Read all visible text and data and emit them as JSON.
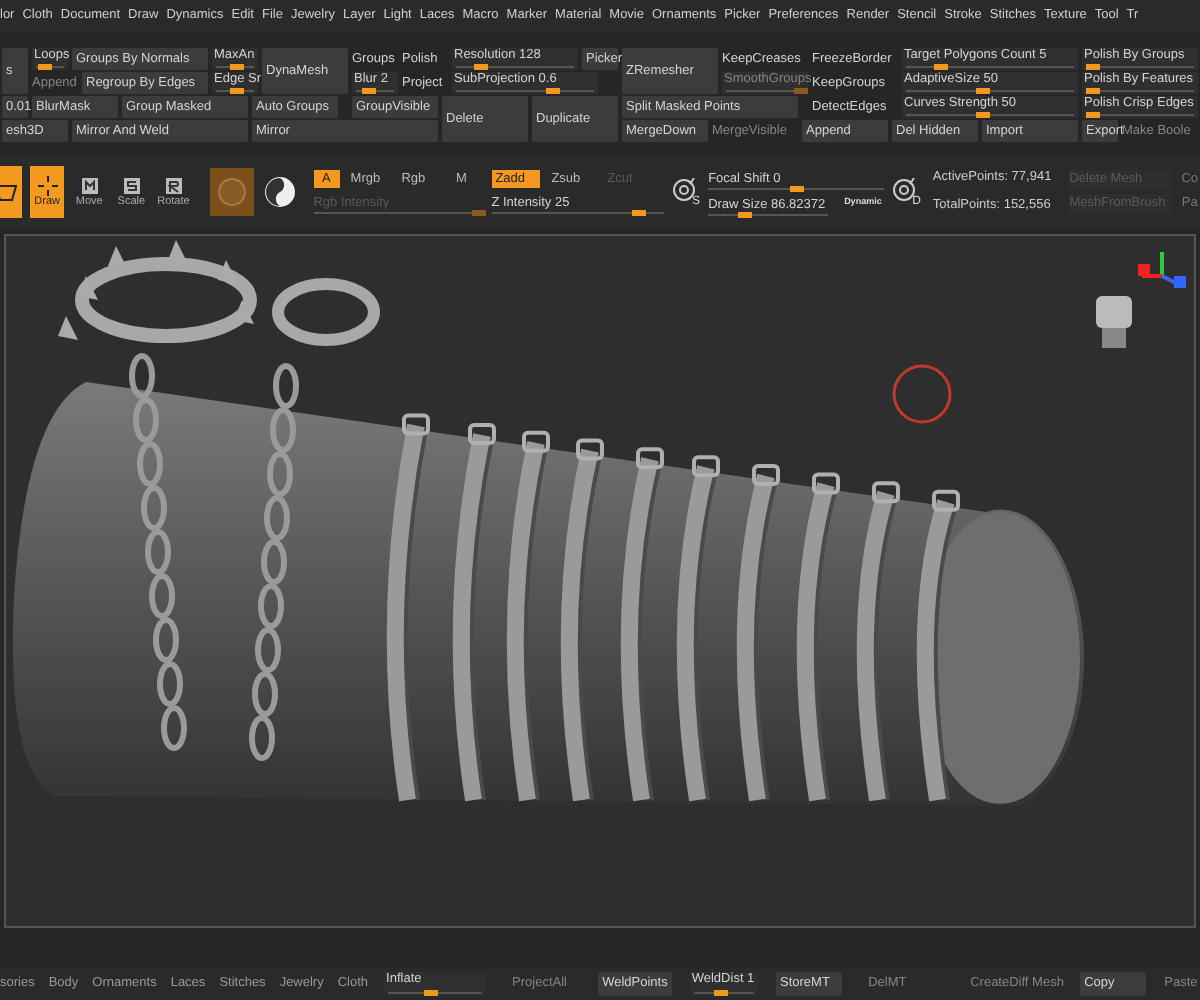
{
  "menu_bar": [
    "lor",
    "Cloth",
    "Document",
    "Draw",
    "Dynamics",
    "Edit",
    "File",
    "Jewelry",
    "Layer",
    "Light",
    "Laces",
    "Macro",
    "Marker",
    "Material",
    "Movie",
    "Ornaments",
    "Picker",
    "Preferences",
    "Render",
    "Stencil",
    "Stroke",
    "Stitches",
    "Texture",
    "Tool",
    "Tr"
  ],
  "palette": [
    {
      "label": "s",
      "kind": "button",
      "disabled": false
    },
    {
      "label": "Loops",
      "kind": "slider",
      "disabled": false,
      "level": 0.3
    },
    {
      "label": "Groups By Normals",
      "kind": "button",
      "disabled": false
    },
    {
      "label": "MaxAn",
      "kind": "slider",
      "disabled": false,
      "level": 0.5
    },
    {
      "label": "DynaMesh",
      "kind": "button",
      "disabled": false
    },
    {
      "label": "Groups",
      "kind": "toggle",
      "disabled": false
    },
    {
      "label": "Polish",
      "kind": "toggle",
      "disabled": false
    },
    {
      "label": "Resolution 128",
      "kind": "slider",
      "disabled": false,
      "level": 0.2
    },
    {
      "label": "Picker",
      "kind": "button",
      "disabled": false
    },
    {
      "label": "ZRemesher",
      "kind": "button",
      "disabled": false
    },
    {
      "label": "KeepCreases",
      "kind": "toggle",
      "disabled": false
    },
    {
      "label": "FreezeBorder",
      "kind": "toggle",
      "disabled": false
    },
    {
      "label": "Target Polygons Count 5",
      "kind": "slider",
      "disabled": false,
      "level": 0.2
    },
    {
      "label": "Polish By Groups",
      "kind": "slider",
      "disabled": false,
      "level": 0.05
    },
    {
      "label": "Append",
      "kind": "toggle",
      "disabled": true
    },
    {
      "label": "Regroup By Edges",
      "kind": "button",
      "disabled": false
    },
    {
      "label": "Edge Sr",
      "kind": "slider",
      "disabled": false,
      "level": 0.5
    },
    {
      "label": "Blur 2",
      "kind": "slider",
      "disabled": false,
      "level": 0.3
    },
    {
      "label": "Project",
      "kind": "toggle",
      "disabled": false
    },
    {
      "label": "SubProjection 0.6",
      "kind": "slider",
      "disabled": false,
      "level": 0.7
    },
    {
      "label": "SmoothGroups",
      "kind": "slider",
      "disabled": true,
      "level": 0.95
    },
    {
      "label": "KeepGroups",
      "kind": "toggle",
      "disabled": false
    },
    {
      "label": "AdaptiveSize 50",
      "kind": "slider",
      "disabled": false,
      "level": 0.45
    },
    {
      "label": "Polish By Features",
      "kind": "slider",
      "disabled": false,
      "level": 0.05
    },
    {
      "label": "0.01",
      "kind": "button",
      "disabled": false
    },
    {
      "label": "BlurMask",
      "kind": "button",
      "disabled": false
    },
    {
      "label": "Group Masked",
      "kind": "button",
      "disabled": false
    },
    {
      "label": "Auto Groups",
      "kind": "button",
      "disabled": false
    },
    {
      "label": "GroupVisible",
      "kind": "button",
      "disabled": false
    },
    {
      "label": "Delete",
      "kind": "button",
      "disabled": false
    },
    {
      "label": "Duplicate",
      "kind": "button",
      "disabled": false
    },
    {
      "label": "Split Masked Points",
      "kind": "button",
      "disabled": false
    },
    {
      "label": "DetectEdges",
      "kind": "toggle",
      "disabled": false
    },
    {
      "label": "Curves Strength 50",
      "kind": "slider",
      "disabled": false,
      "level": 0.45
    },
    {
      "label": "Polish Crisp Edges",
      "kind": "slider",
      "disabled": false,
      "level": 0.05
    },
    {
      "label": "esh3D",
      "kind": "button",
      "disabled": false
    },
    {
      "label": "Mirror And Weld",
      "kind": "button",
      "disabled": false
    },
    {
      "label": "Mirror",
      "kind": "button",
      "disabled": false
    },
    {
      "label": "MergeDown",
      "kind": "button",
      "disabled": false
    },
    {
      "label": "MergeVisible",
      "kind": "toggle",
      "disabled": true
    },
    {
      "label": "Append",
      "kind": "button",
      "disabled": false
    },
    {
      "label": "Del Hidden",
      "kind": "button",
      "disabled": false
    },
    {
      "label": "Import",
      "kind": "button",
      "disabled": false
    },
    {
      "label": "Export",
      "kind": "button",
      "disabled": false
    },
    {
      "label": "Make Boole",
      "kind": "toggle",
      "disabled": true
    }
  ],
  "toolbar": {
    "tools": [
      {
        "kind": "edit",
        "selected": true
      },
      {
        "kind": "draw",
        "label": "Draw",
        "selected": true
      },
      {
        "kind": "move",
        "label": "Move",
        "selected": false
      },
      {
        "kind": "scale",
        "label": "Scale",
        "selected": false
      },
      {
        "kind": "rotate",
        "label": "Rotate",
        "selected": false
      }
    ],
    "channels": [
      {
        "label": "A",
        "selected": true
      },
      {
        "label": "Mrgb",
        "selected": false
      },
      {
        "label": "Rgb",
        "selected": false
      },
      {
        "label": "M",
        "selected": false
      }
    ],
    "depth_modes": [
      {
        "label": "Zadd",
        "selected": true,
        "disabled": false
      },
      {
        "label": "Zsub",
        "selected": false,
        "disabled": false
      },
      {
        "label": "Zcut",
        "selected": false,
        "disabled": true
      }
    ],
    "rgb_intensity": {
      "label": "Rgb Intensity",
      "disabled": true,
      "level": 0.98
    },
    "z_intensity": {
      "label": "Z Intensity 25",
      "disabled": false,
      "level": 0.85
    },
    "focal_icon_letter": "S",
    "focal_shift": {
      "label": "Focal Shift 0",
      "level": 0.5
    },
    "draw_size": {
      "label": "Draw Size 86.82372",
      "level": 0.3
    },
    "dynamic": "Dynamic",
    "draw_icon_letter": "D",
    "stats": [
      "ActivePoints: 77,941",
      "TotalPoints: 152,556"
    ],
    "mesh_buttons": [
      {
        "label": "Delete Mesh",
        "disabled": true
      },
      {
        "label": "MeshFromBrush",
        "disabled": true
      }
    ],
    "cut_labels": [
      "Co",
      "Pa"
    ]
  },
  "bottom_bar": {
    "tabs": [
      "sories",
      "Body",
      "Ornaments",
      "Laces",
      "Stitches",
      "Jewelry",
      "Cloth"
    ],
    "items": [
      {
        "label": "Inflate",
        "kind": "slider",
        "disabled": false,
        "level": 0.45
      },
      {
        "label": "ProjectAll",
        "kind": "toggle",
        "disabled": true
      },
      {
        "label": "WeldPoints",
        "kind": "button",
        "disabled": false
      },
      {
        "label": "WeldDist 1",
        "kind": "slider",
        "disabled": false,
        "level": 0.45
      },
      {
        "label": "StoreMT",
        "kind": "button",
        "disabled": false
      },
      {
        "label": "DelMT",
        "kind": "toggle",
        "disabled": true
      },
      {
        "label": "CreateDiff Mesh",
        "kind": "toggle",
        "disabled": true
      },
      {
        "label": "Copy",
        "kind": "button",
        "disabled": false
      },
      {
        "label": "Paste",
        "kind": "toggle",
        "disabled": true
      }
    ]
  }
}
